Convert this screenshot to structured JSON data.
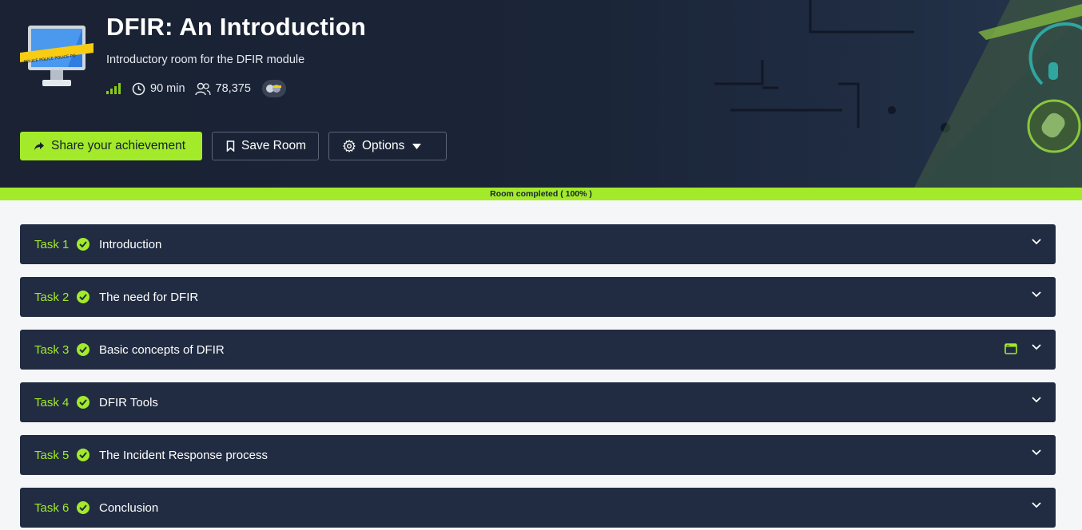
{
  "room": {
    "title": "DFIR: An Introduction",
    "subtitle": "Introductory room for the DFIR module",
    "icon": "police-tape-monitor-icon",
    "duration": "90 min",
    "users": "78,375",
    "difficulty_icon": "difficulty-bars-icon"
  },
  "actions": {
    "share_label": "Share your achievement",
    "save_label": "Save Room",
    "options_label": "Options"
  },
  "progress": {
    "label": "Room completed ( 100% )",
    "percent": 100
  },
  "tasks": [
    {
      "num": "Task 1",
      "title": "Introduction"
    },
    {
      "num": "Task 2",
      "title": "The need for DFIR"
    },
    {
      "num": "Task 3",
      "title": "Basic concepts of DFIR"
    },
    {
      "num": "Task 4",
      "title": "DFIR Tools"
    },
    {
      "num": "Task 5",
      "title": "The Incident Response process"
    },
    {
      "num": "Task 6",
      "title": "Conclusion"
    }
  ],
  "colors": {
    "accent": "#a3ea2a",
    "hero_bg": "#1a2233",
    "task_bg": "#212c42"
  }
}
